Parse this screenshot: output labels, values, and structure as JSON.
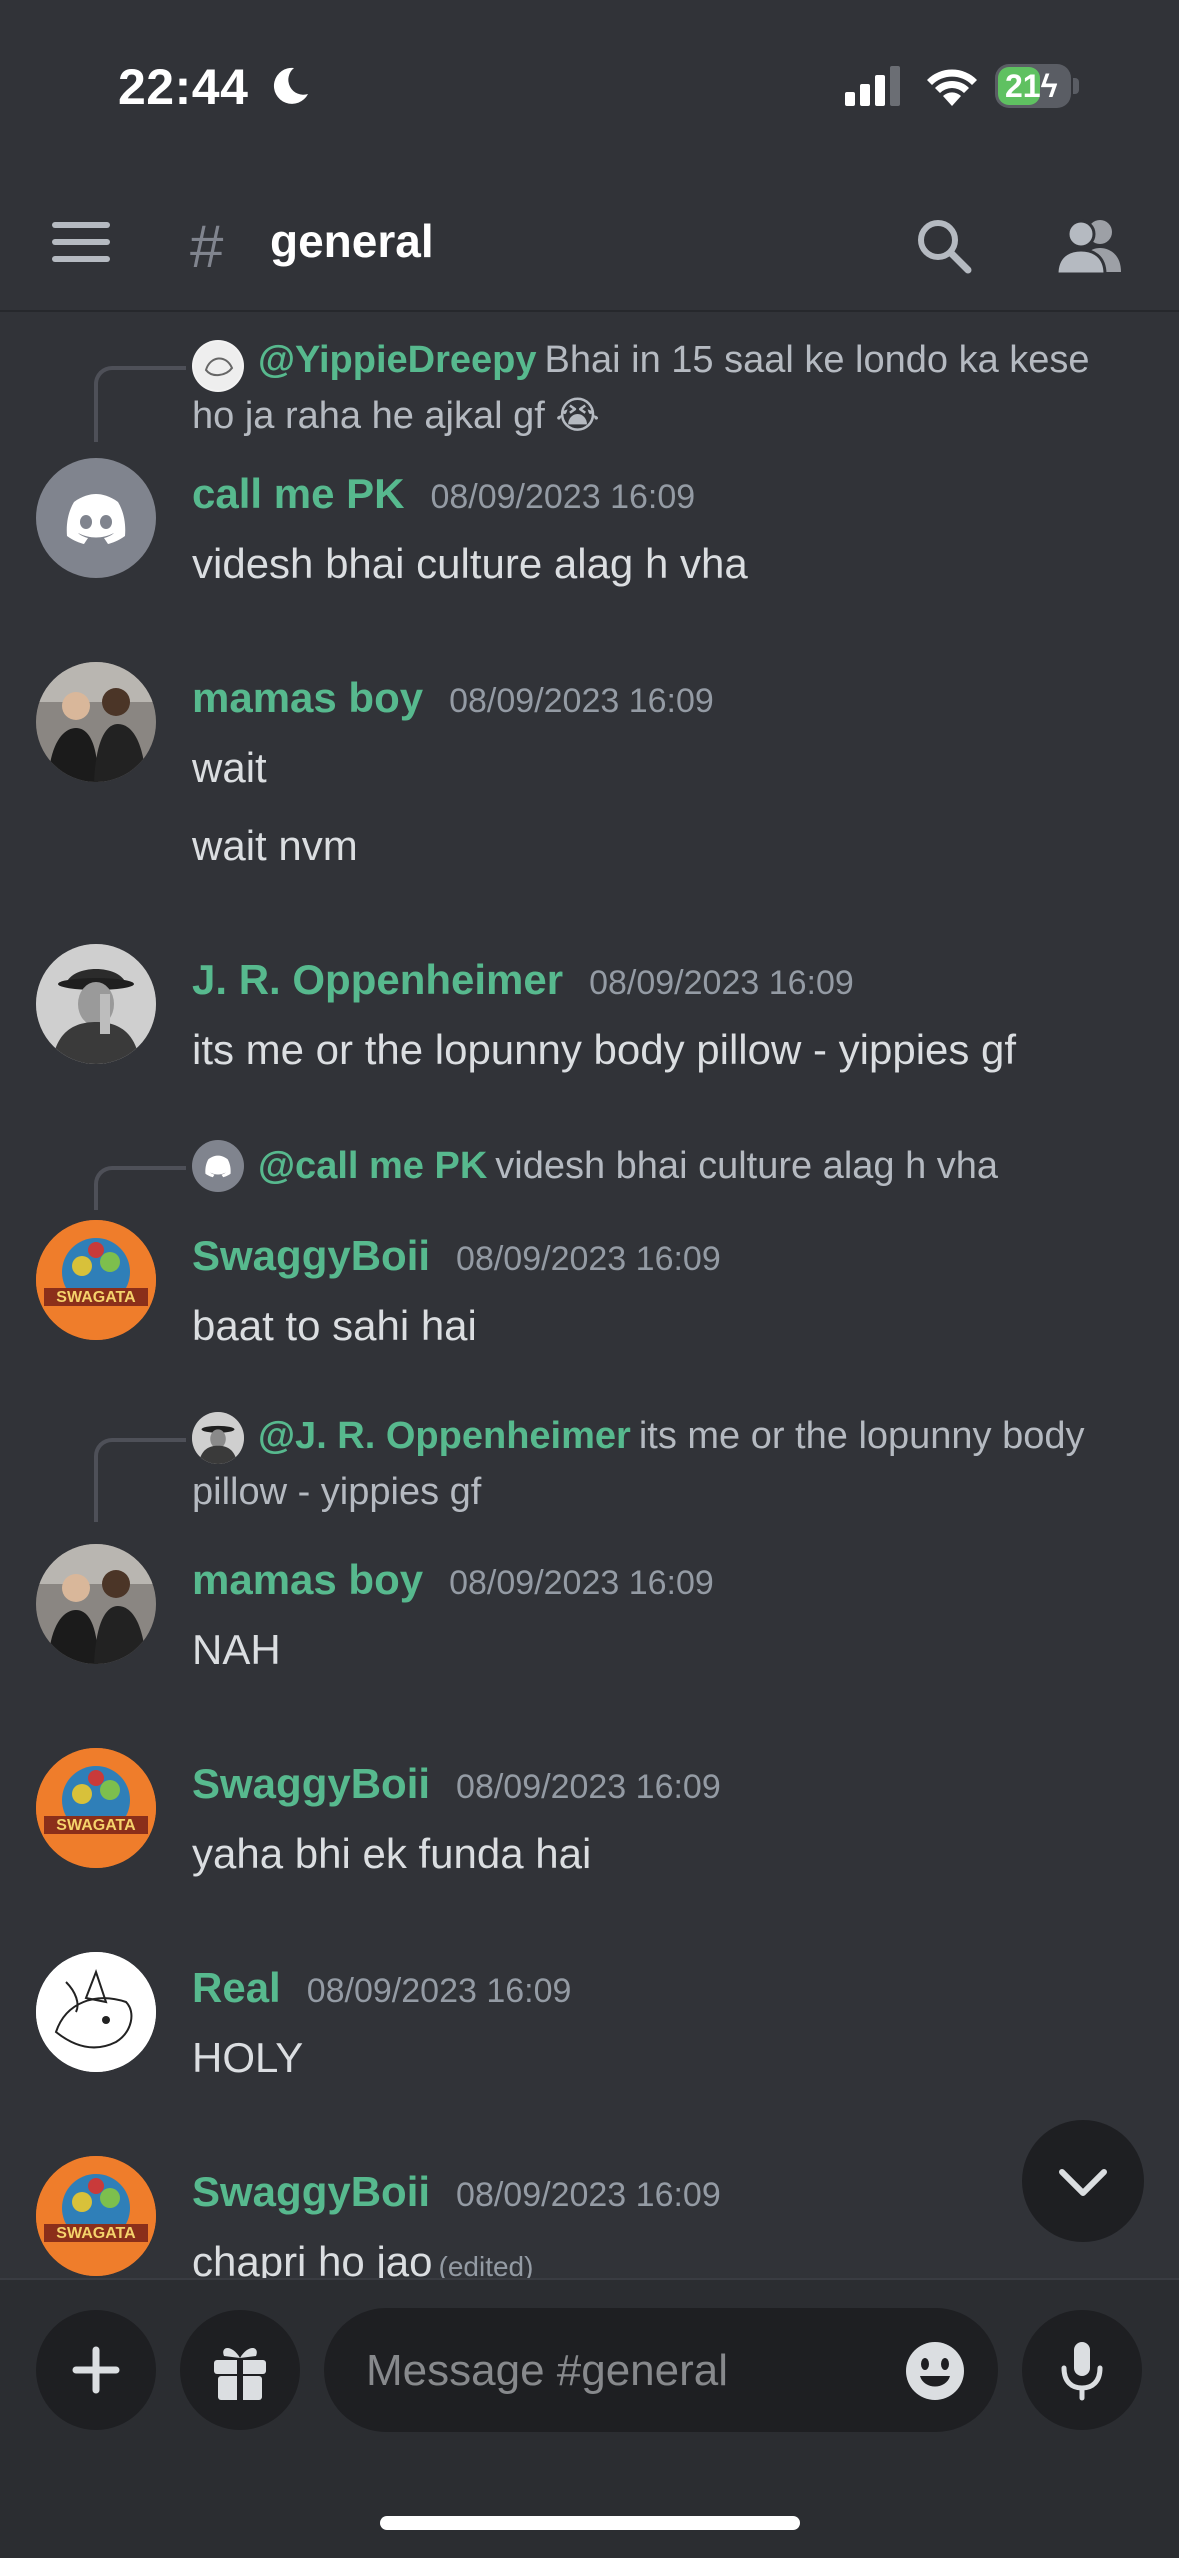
{
  "status": {
    "time": "22:44",
    "battery": "21",
    "battery_level": 0.21
  },
  "header": {
    "channel_hash": "#",
    "channel_name": "general"
  },
  "messages": [
    {
      "reply": {
        "name": "@YippieDreepy",
        "text": "Bhai in 15 saal ke londo ka kese ho ja raha he ajkal gf 😭"
      },
      "author": "call me PK",
      "timestamp": "08/09/2023 16:09",
      "lines": [
        "videsh bhai culture alag h vha"
      ]
    },
    {
      "author": "mamas boy",
      "timestamp": "08/09/2023 16:09",
      "lines": [
        "wait",
        "wait nvm"
      ]
    },
    {
      "author": "J. R. Oppenheimer",
      "timestamp": "08/09/2023 16:09",
      "lines": [
        "its me or the lopunny body pillow - yippies gf"
      ]
    },
    {
      "reply": {
        "name": "@call me PK",
        "text": "videsh bhai culture alag h vha"
      },
      "author": "SwaggyBoii",
      "timestamp": "08/09/2023 16:09",
      "lines": [
        "baat to sahi hai"
      ]
    },
    {
      "reply": {
        "name": "@J. R. Oppenheimer",
        "text": "its me or the lopunny body pillow - yippies gf"
      },
      "author": "mamas boy",
      "timestamp": "08/09/2023 16:09",
      "lines": [
        "NAH"
      ]
    },
    {
      "author": "SwaggyBoii",
      "timestamp": "08/09/2023 16:09",
      "lines": [
        "yaha bhi ek funda hai"
      ]
    },
    {
      "author": "Real",
      "timestamp": "08/09/2023 16:09",
      "lines": [
        "HOLY"
      ]
    },
    {
      "author": "SwaggyBoii",
      "timestamp": "08/09/2023 16:09",
      "lines": [
        "chapri ho jao"
      ],
      "edited": "(edited)"
    }
  ],
  "composer": {
    "placeholder": "Message #general"
  },
  "colors": {
    "background": "#313338",
    "username": "#57b98e",
    "composer": "#2b2d31"
  }
}
